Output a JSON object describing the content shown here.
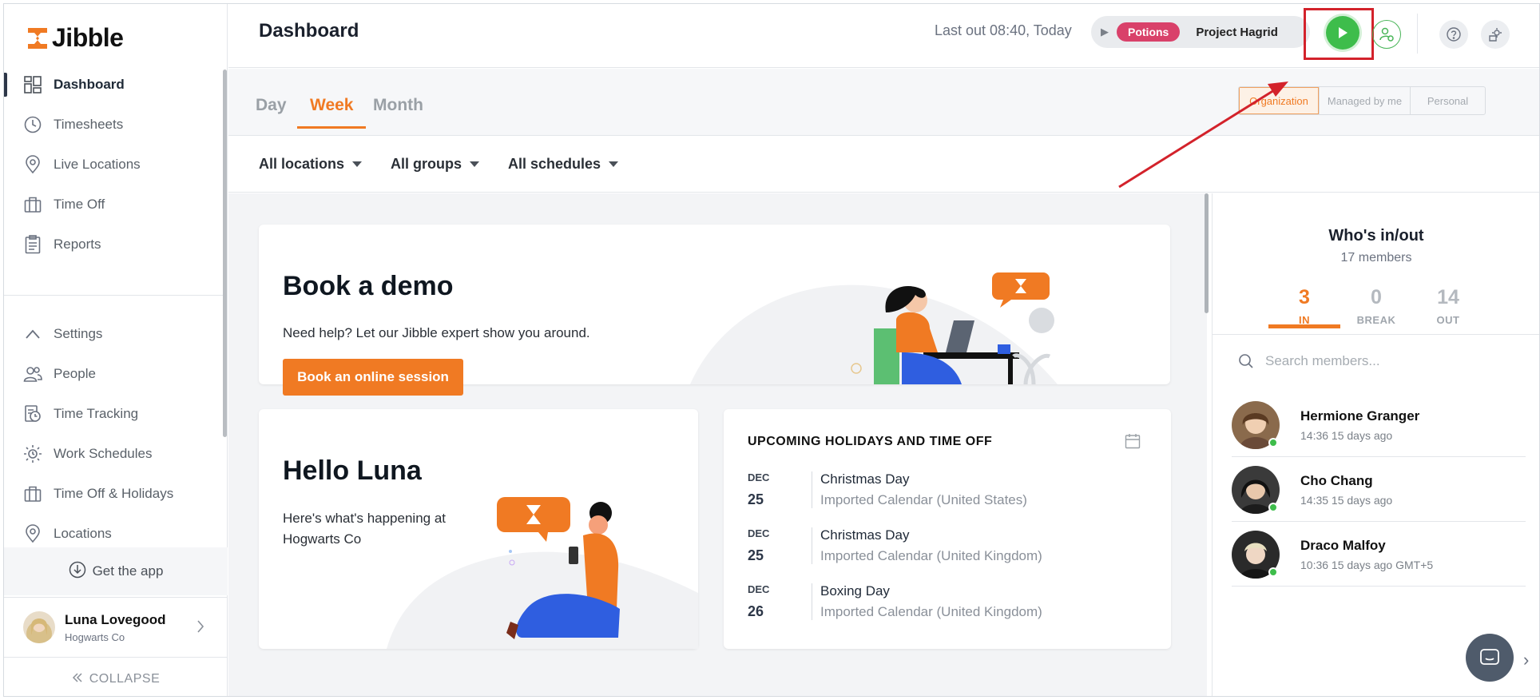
{
  "app": {
    "name": "Jibble",
    "brand_color": "#f07a23"
  },
  "sidebar": {
    "items": [
      {
        "label": "Dashboard",
        "icon": "dashboard-icon"
      },
      {
        "label": "Timesheets",
        "icon": "clock-icon"
      },
      {
        "label": "Live Locations",
        "icon": "map-pin-icon"
      },
      {
        "label": "Time Off",
        "icon": "briefcase-icon"
      },
      {
        "label": "Reports",
        "icon": "clipboard-icon"
      }
    ],
    "settings_items": [
      {
        "label": "Settings",
        "icon": "chevron-up-icon"
      },
      {
        "label": "People",
        "icon": "people-icon"
      },
      {
        "label": "Time Tracking",
        "icon": "time-tracking-icon"
      },
      {
        "label": "Work Schedules",
        "icon": "schedule-icon"
      },
      {
        "label": "Time Off & Holidays",
        "icon": "briefcase-icon"
      },
      {
        "label": "Locations",
        "icon": "map-pin-icon"
      }
    ],
    "get_app": "Get the app",
    "user": {
      "name": "Luna Lovegood",
      "company": "Hogwarts Co"
    },
    "collapse": "COLLAPSE"
  },
  "header": {
    "title": "Dashboard",
    "last_out": "Last out 08:40, Today",
    "activity_tag": "Potions",
    "project": "Project Hagrid"
  },
  "tabs": {
    "items": [
      "Day",
      "Week",
      "Month"
    ],
    "active": "Week"
  },
  "scope": {
    "items": [
      "Organization",
      "Managed by me",
      "Personal"
    ],
    "active": "Organization"
  },
  "filters": [
    "All locations",
    "All groups",
    "All schedules"
  ],
  "demo_card": {
    "title": "Book a demo",
    "subtitle": "Need help? Let our Jibble expert show you around.",
    "button": "Book an online session"
  },
  "hello_card": {
    "title": "Hello Luna",
    "subtitle": "Here's what's happening at Hogwarts Co"
  },
  "holidays_card": {
    "title": "UPCOMING HOLIDAYS AND TIME OFF",
    "items": [
      {
        "month": "DEC",
        "day": "25",
        "name": "Christmas Day",
        "calendar": "Imported Calendar (United States)"
      },
      {
        "month": "DEC",
        "day": "25",
        "name": "Christmas Day",
        "calendar": "Imported Calendar (United Kingdom)"
      },
      {
        "month": "DEC",
        "day": "26",
        "name": "Boxing Day",
        "calendar": "Imported Calendar (United Kingdom)"
      }
    ]
  },
  "who_panel": {
    "title": "Who's in/out",
    "subtitle": "17 members",
    "stats": [
      {
        "value": "3",
        "label": "IN"
      },
      {
        "value": "0",
        "label": "BREAK"
      },
      {
        "value": "14",
        "label": "OUT"
      }
    ],
    "search_placeholder": "Search members...",
    "members": [
      {
        "name": "Hermione Granger",
        "time": "14:36 15 days ago"
      },
      {
        "name": "Cho Chang",
        "time": "14:35 15 days ago"
      },
      {
        "name": "Draco Malfoy",
        "time": "10:36 15 days ago GMT+5"
      }
    ]
  }
}
